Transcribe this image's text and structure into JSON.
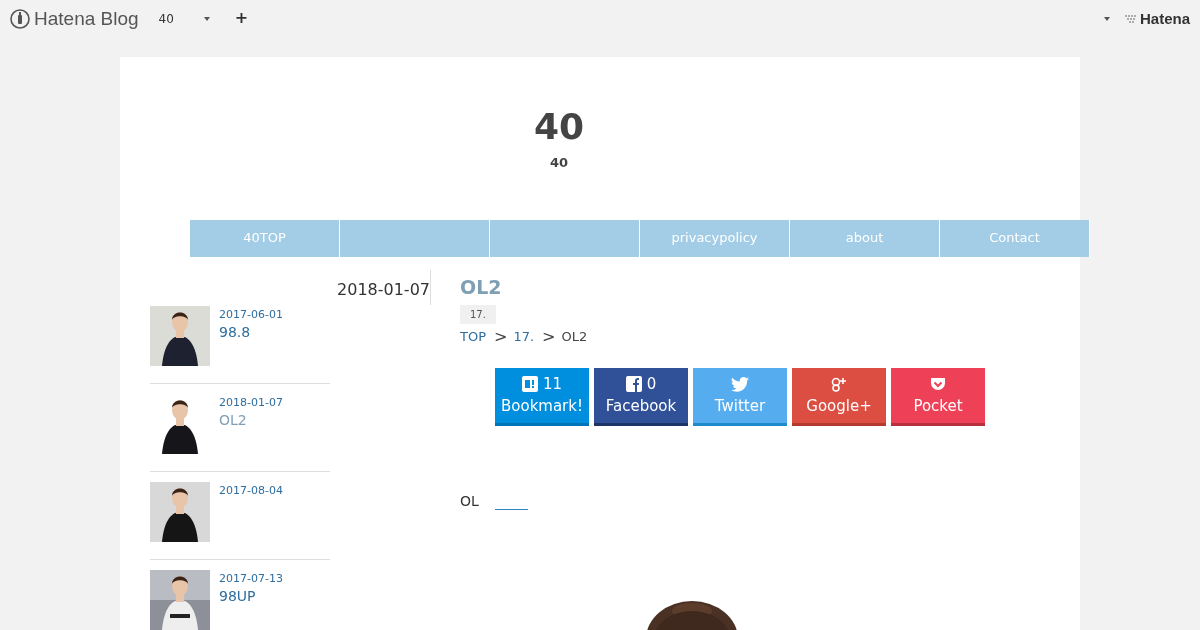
{
  "top_bar": {
    "logo": "Hatena Blog",
    "blog_name": "40",
    "add": "+",
    "brand": "Hatena"
  },
  "header": {
    "title": "40",
    "subtitle": "40"
  },
  "nav": [
    {
      "kind": "link",
      "label": "40TOP"
    },
    {
      "kind": "blank"
    },
    {
      "kind": "blank"
    },
    {
      "kind": "link",
      "label": "privacypolicy"
    },
    {
      "kind": "link",
      "label": "about"
    },
    {
      "kind": "link",
      "label": "Contact"
    }
  ],
  "sidebar": {
    "posts": [
      {
        "date": "2017-06-01",
        "title": "98.8",
        "visited": false
      },
      {
        "date": "2018-01-07",
        "title": "OL2",
        "visited": true
      },
      {
        "date": "2017-08-04"
      },
      {
        "date": "2017-07-13",
        "title": "98UP",
        "visited": false
      }
    ]
  },
  "article": {
    "date": "2018-01-07",
    "title": "OL2",
    "category": "17.",
    "breadcrumb": [
      {
        "kind": "link",
        "label": "TOP"
      },
      {
        "kind": "sep",
        "label": ">"
      },
      {
        "kind": "link",
        "label": "17."
      },
      {
        "kind": "sep",
        "label": ">"
      },
      {
        "kind": "current",
        "label": "OL2"
      }
    ],
    "share": [
      {
        "kind": "hatena",
        "count": "11",
        "label": "Bookmark!"
      },
      {
        "kind": "facebook",
        "count": "0",
        "label": "Facebook"
      },
      {
        "kind": "twitter",
        "label": "Twitter"
      },
      {
        "kind": "google",
        "label": "Google+"
      },
      {
        "kind": "pocket",
        "label": "Pocket"
      }
    ],
    "body_text": "OL"
  }
}
